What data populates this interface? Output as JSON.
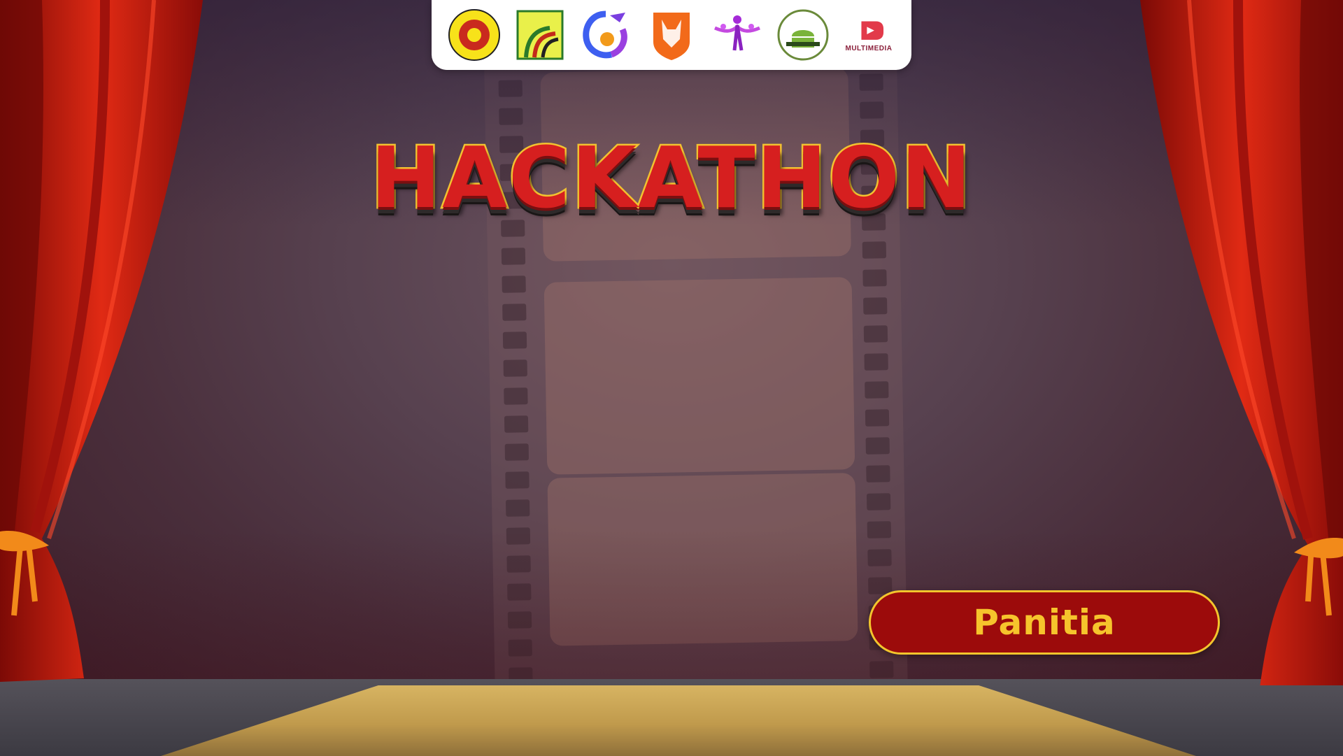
{
  "title": "HACKATHON",
  "panitia_label": "Panitia",
  "sponsors": [
    {
      "name": "university-crest-logo",
      "text": ""
    },
    {
      "name": "fik-faculty-logo",
      "text": ""
    },
    {
      "name": "swirl-community-logo",
      "text": ""
    },
    {
      "name": "fox-shield-logo",
      "text": ""
    },
    {
      "name": "dancers-logo",
      "text": ""
    },
    {
      "name": "android-community-logo",
      "text": ""
    },
    {
      "name": "multimedia-logo",
      "text": "MULTIMEDIA"
    }
  ],
  "colors": {
    "curtain": "#c8180f",
    "button_bg": "#9c0b0b",
    "button_text": "#f6c42c",
    "stage": "#d7b462"
  }
}
